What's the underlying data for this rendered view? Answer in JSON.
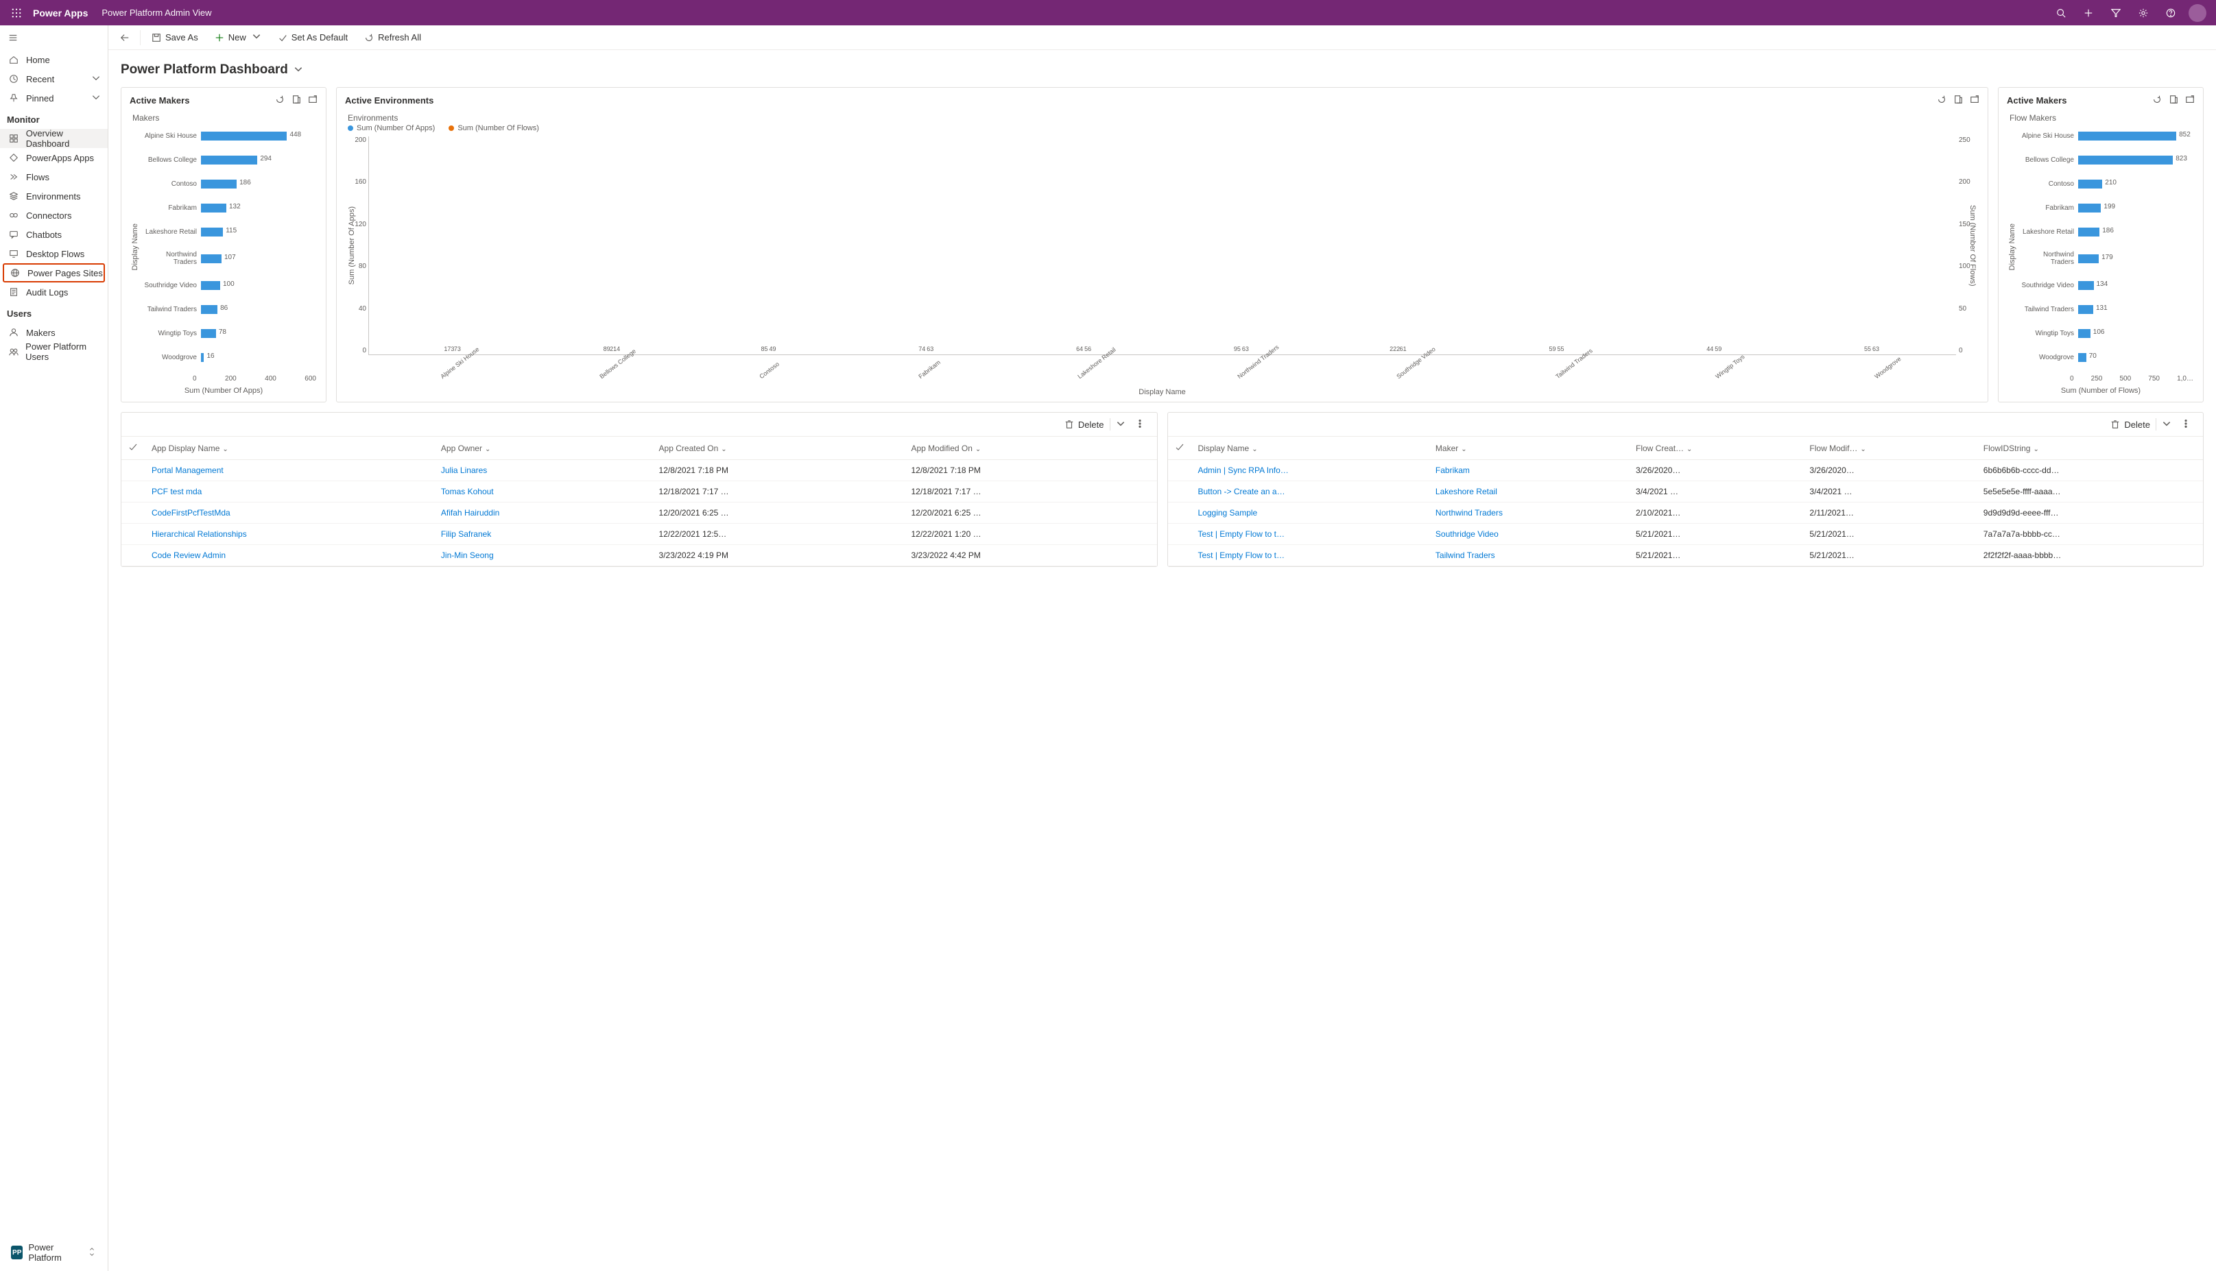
{
  "header": {
    "app_title": "Power Apps",
    "sub_title": "Power Platform Admin View"
  },
  "sidebar": {
    "top": [
      {
        "label": "Home",
        "icon": "home"
      },
      {
        "label": "Recent",
        "icon": "clock",
        "expand": true
      },
      {
        "label": "Pinned",
        "icon": "pin",
        "expand": true
      }
    ],
    "monitor_h": "Monitor",
    "monitor": [
      {
        "label": "Overview Dashboard",
        "icon": "grid",
        "selected": true
      },
      {
        "label": "PowerApps Apps",
        "icon": "diamond"
      },
      {
        "label": "Flows",
        "icon": "flow"
      },
      {
        "label": "Environments",
        "icon": "stack"
      },
      {
        "label": "Connectors",
        "icon": "connector"
      },
      {
        "label": "Chatbots",
        "icon": "chat"
      },
      {
        "label": "Desktop Flows",
        "icon": "desktop"
      },
      {
        "label": "Power Pages Sites",
        "icon": "globe",
        "highlighted": true
      },
      {
        "label": "Audit Logs",
        "icon": "log"
      }
    ],
    "users_h": "Users",
    "users": [
      {
        "label": "Makers",
        "icon": "person"
      },
      {
        "label": "Power Platform Users",
        "icon": "people"
      }
    ],
    "env_badge": "PP",
    "env_name": "Power Platform"
  },
  "cmdbar": {
    "save_as": "Save As",
    "new": "New",
    "set_default": "Set As Default",
    "refresh": "Refresh All"
  },
  "page_title": "Power Platform Dashboard",
  "card1": {
    "title": "Active Makers",
    "subtitle": "Makers",
    "ylabel": "Display Name",
    "xlabel": "Sum (Number Of Apps)",
    "xticks": [
      "0",
      "200",
      "400",
      "600"
    ]
  },
  "card2": {
    "title": "Active Environments",
    "subtitle": "Environments",
    "legend1": "Sum (Number Of Apps)",
    "legend2": "Sum (Number Of Flows)",
    "ylabel": "Sum (Number Of Apps)",
    "y2label": "Sum (Number Of Flows)",
    "xlabel": "Display Name",
    "yticks": [
      "200",
      "160",
      "120",
      "80",
      "40",
      "0"
    ],
    "y2ticks": [
      "250",
      "200",
      "150",
      "100",
      "50",
      "0"
    ]
  },
  "card3": {
    "title": "Active Makers",
    "subtitle": "Flow Makers",
    "ylabel": "Display Name",
    "xlabel": "Sum (Number of Flows)",
    "xticks": [
      "0",
      "250",
      "500",
      "750",
      "1,0…"
    ]
  },
  "chart_data": {
    "makers_apps": {
      "type": "bar",
      "orientation": "horizontal",
      "ylabel": "Display Name",
      "xlabel": "Sum (Number Of Apps)",
      "xlim": [
        0,
        600
      ],
      "categories": [
        "Alpine Ski House",
        "Bellows College",
        "Contoso",
        "Fabrikam",
        "Lakeshore Retail",
        "Northwind Traders",
        "Southridge Video",
        "Tailwind Traders",
        "Wingtip Toys",
        "Woodgrove"
      ],
      "values": [
        448,
        294,
        186,
        132,
        115,
        107,
        100,
        86,
        78,
        16
      ]
    },
    "environments": {
      "type": "bar",
      "grouped": true,
      "ylabel": "Sum (Number Of Apps)",
      "y2label": "Sum (Number Of Flows)",
      "xlabel": "Display Name",
      "ylim": [
        0,
        200
      ],
      "y2lim": [
        0,
        250
      ],
      "categories": [
        "Alpine Ski House",
        "Bellows College",
        "Contoso",
        "Fabrikam",
        "Lakeshore Retail",
        "Northwind Traders",
        "Southridge Video",
        "Tailwind Traders",
        "Wingtip Toys",
        "Woodgrove"
      ],
      "series": [
        {
          "name": "Sum (Number Of Apps)",
          "axis": "left",
          "values": [
            173,
            89,
            214,
            85,
            74,
            64,
            95,
            222,
            59,
            44,
            55,
            63
          ]
        },
        {
          "name": "Sum (Number Of Flows)",
          "axis": "right",
          "values": [
            73,
            89,
            214,
            49,
            63,
            56,
            63,
            61,
            55,
            59,
            55,
            63
          ]
        }
      ],
      "apps": [
        173,
        89,
        214,
        85,
        74,
        64,
        95,
        222,
        59,
        44,
        55,
        63
      ],
      "flows": [
        73,
        89,
        214,
        49,
        63,
        56,
        63,
        61,
        55,
        59,
        55,
        63
      ],
      "pairs": [
        {
          "a": 173,
          "f": 73
        },
        {
          "a": 89,
          "f": 214
        },
        {
          "a": 85,
          "f": 49
        },
        {
          "a": 74,
          "f": 63
        },
        {
          "a": 64,
          "f": 56
        },
        {
          "a": 95,
          "f": 63
        },
        {
          "a": 222,
          "f": 61
        },
        {
          "a": 59,
          "f": 55
        },
        {
          "a": 44,
          "f": 59
        },
        {
          "a": 55,
          "f": 63
        }
      ]
    },
    "flow_makers": {
      "type": "bar",
      "orientation": "horizontal",
      "ylabel": "Display Name",
      "xlabel": "Sum (Number of Flows)",
      "xlim": [
        0,
        1000
      ],
      "categories": [
        "Alpine Ski House",
        "Bellows College",
        "Contoso",
        "Fabrikam",
        "Lakeshore Retail",
        "Northwind Traders",
        "Southridge Video",
        "Tailwind Traders",
        "Wingtip Toys",
        "Woodgrove"
      ],
      "values": [
        852,
        823,
        210,
        199,
        186,
        179,
        134,
        131,
        106,
        70
      ]
    }
  },
  "delete_label": "Delete",
  "table1": {
    "cols": [
      "App Display Name",
      "App Owner",
      "App Created On",
      "App Modified On"
    ],
    "rows": [
      {
        "name": "Portal Management",
        "owner": "Julia Linares",
        "created": "12/8/2021 7:18 PM",
        "modified": "12/8/2021 7:18 PM"
      },
      {
        "name": "PCF test mda",
        "owner": "Tomas Kohout",
        "created": "12/18/2021 7:17 …",
        "modified": "12/18/2021 7:17 …"
      },
      {
        "name": "CodeFirstPcfTestMda",
        "owner": "Afifah Hairuddin",
        "created": "12/20/2021 6:25 …",
        "modified": "12/20/2021 6:25 …"
      },
      {
        "name": "Hierarchical Relationships",
        "owner": "Filip Safranek",
        "created": "12/22/2021 12:5…",
        "modified": "12/22/2021 1:20 …"
      },
      {
        "name": "Code Review Admin",
        "owner": "Jin-Min Seong",
        "created": "3/23/2022 4:19 PM",
        "modified": "3/23/2022 4:42 PM"
      }
    ]
  },
  "table2": {
    "cols": [
      "Display Name",
      "Maker",
      "Flow Creat…",
      "Flow Modif…",
      "FlowIDString"
    ],
    "rows": [
      {
        "name": "Admin | Sync RPA Info…",
        "maker": "Fabrikam",
        "created": "3/26/2020…",
        "modified": "3/26/2020…",
        "id": "6b6b6b6b-cccc-dd…"
      },
      {
        "name": "Button -> Create an a…",
        "maker": "Lakeshore Retail",
        "created": "3/4/2021 …",
        "modified": "3/4/2021 …",
        "id": "5e5e5e5e-ffff-aaaa…"
      },
      {
        "name": "Logging Sample",
        "maker": "Northwind Traders",
        "created": "2/10/2021…",
        "modified": "2/11/2021…",
        "id": "9d9d9d9d-eeee-fff…"
      },
      {
        "name": "Test | Empty Flow to t…",
        "maker": "Southridge Video",
        "created": "5/21/2021…",
        "modified": "5/21/2021…",
        "id": "7a7a7a7a-bbbb-cc…"
      },
      {
        "name": "Test | Empty Flow to t…",
        "maker": "Tailwind Traders",
        "created": "5/21/2021…",
        "modified": "5/21/2021…",
        "id": "2f2f2f2f-aaaa-bbbb…"
      }
    ]
  }
}
